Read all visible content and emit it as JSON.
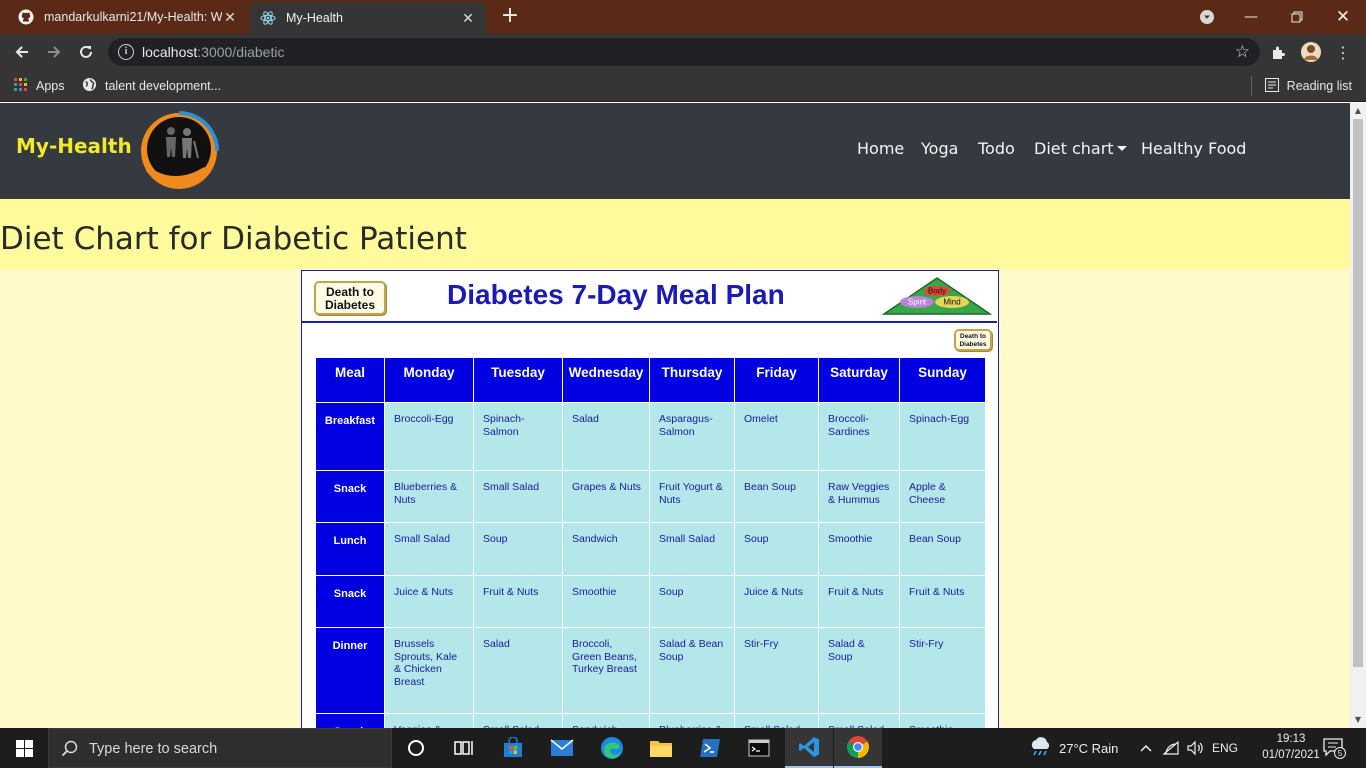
{
  "browser": {
    "tabs": [
      {
        "label": "mandarkulkarni21/My-Health: W",
        "icon": "github-icon",
        "active": false
      },
      {
        "label": "My-Health",
        "icon": "react-icon",
        "active": true
      }
    ],
    "url_host": "localhost",
    "url_rest": ":3000/diabetic",
    "bookmarks": [
      {
        "label": "Apps",
        "icon": "apps-grid-icon"
      },
      {
        "label": "talent development...",
        "icon": "globe-icon"
      }
    ],
    "reading_list": "Reading list"
  },
  "site": {
    "brand": "My-Health",
    "nav": {
      "home": "Home",
      "yoga": "Yoga",
      "todo": "Todo",
      "diet": "Diet chart",
      "healthy": "Healthy Food"
    },
    "page_title": "Diet Chart for Diabetic Patient"
  },
  "meal_plan": {
    "badge": "Death to Diabetes",
    "title": "Diabetes 7-Day Meal Plan",
    "pyramid": {
      "top": "Body",
      "left": "Spirit",
      "right": "Mind"
    },
    "columns": [
      "Meal",
      "Monday",
      "Tuesday",
      "Wednesday",
      "Thursday",
      "Friday",
      "Saturday",
      "Sunday"
    ],
    "rows": [
      {
        "meal": "Breakfast",
        "items": [
          "Broccoli-Egg",
          "Spinach-Salmon",
          "Salad",
          "Asparagus-Salmon",
          "Omelet",
          "Broccoli-Sardines",
          "Spinach-Egg"
        ]
      },
      {
        "meal": "Snack",
        "items": [
          "Blueberries & Nuts",
          "Small Salad",
          "Grapes & Nuts",
          "Fruit Yogurt & Nuts",
          "Bean Soup",
          "Raw Veggies & Hummus",
          "Apple & Cheese"
        ]
      },
      {
        "meal": "Lunch",
        "items": [
          "Small Salad",
          "Soup",
          "Sandwich",
          "Small Salad",
          "Soup",
          "Smoothie",
          "Bean Soup"
        ]
      },
      {
        "meal": "Snack",
        "items": [
          "Juice & Nuts",
          "Fruit & Nuts",
          "Smoothie",
          "Soup",
          "Juice & Nuts",
          "Fruit & Nuts",
          "Fruit & Nuts"
        ]
      },
      {
        "meal": "Dinner",
        "items": [
          "Brussels Sprouts, Kale & Chicken Breast",
          "Salad",
          "Broccoli, Green Beans, Turkey Breast",
          "Salad & Bean Soup",
          "Stir-Fry",
          "Salad & Soup",
          "Stir-Fry"
        ]
      },
      {
        "meal": "Snack",
        "items": [
          "Veggies &",
          "Small Salad",
          "Sandwich",
          "Blueberries &",
          "Small Salad",
          "Small Salad",
          "Smoothie"
        ]
      }
    ]
  },
  "taskbar": {
    "search_placeholder": "Type here to search",
    "weather": "27°C  Rain",
    "language": "ENG",
    "time": "19:13",
    "date": "01/07/2021",
    "notifications": "5"
  },
  "colors": {
    "tabbar": "#5b2a17",
    "nav_bg": "#343a40",
    "brand": "#f1ea2c",
    "page_bg": "#fffac8",
    "table_header": "#0000e0",
    "table_cell": "#b3e7e9"
  }
}
